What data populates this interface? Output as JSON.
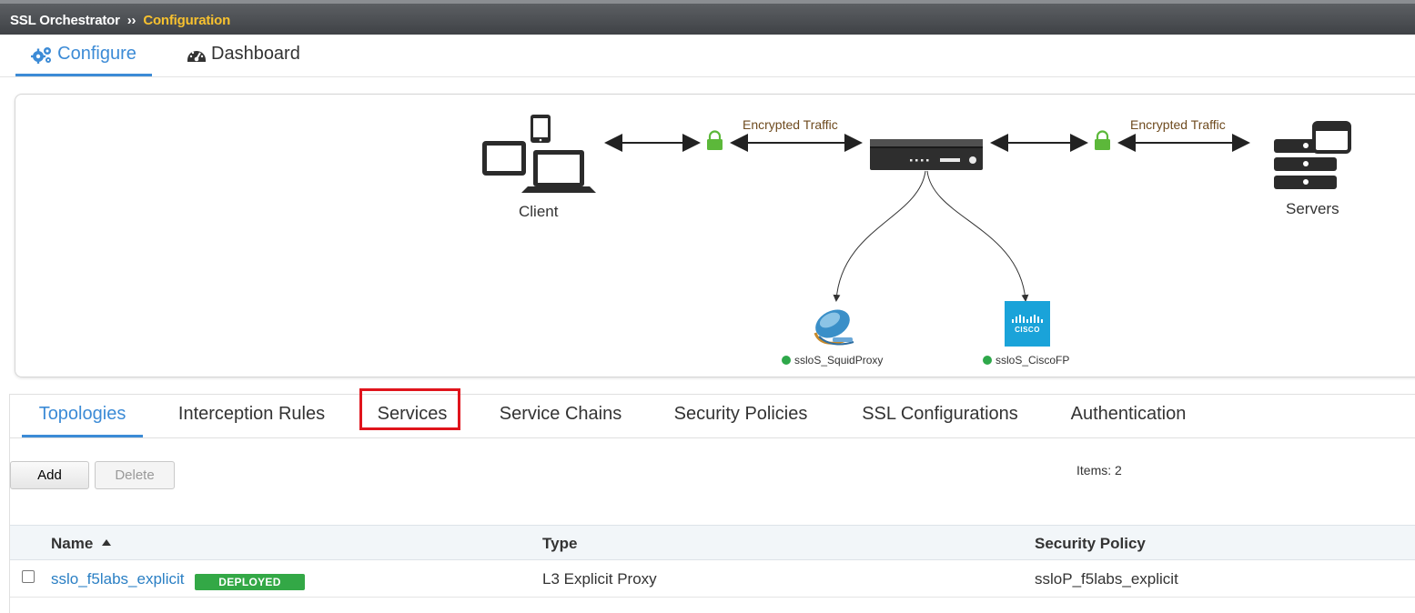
{
  "header": {
    "app_name": "SSL Orchestrator",
    "separator": "››",
    "current": "Configuration"
  },
  "main_tabs": [
    {
      "label": "Configure",
      "icon": "gears-icon",
      "active": true
    },
    {
      "label": "Dashboard",
      "icon": "dashboard-gauge-icon",
      "active": false
    }
  ],
  "diagram": {
    "client_label": "Client",
    "servers_label": "Servers",
    "encrypted_left": "Encrypted Traffic",
    "encrypted_right": "Encrypted Traffic",
    "services": [
      {
        "name": "ssloS_SquidProxy",
        "status": "green",
        "icon": "squid-icon"
      },
      {
        "name": "ssloS_CiscoFP",
        "status": "green",
        "icon": "cisco-logo-icon"
      }
    ],
    "cisco_logo_text": "CISCO"
  },
  "sub_tabs": [
    {
      "label": "Topologies",
      "active": true
    },
    {
      "label": "Interception Rules",
      "active": false
    },
    {
      "label": "Services",
      "active": false,
      "highlighted": true
    },
    {
      "label": "Service Chains",
      "active": false
    },
    {
      "label": "Security Policies",
      "active": false
    },
    {
      "label": "SSL Configurations",
      "active": false
    },
    {
      "label": "Authentication",
      "active": false
    }
  ],
  "toolbar": {
    "add_label": "Add",
    "delete_label": "Delete",
    "items_count": "Items: 2"
  },
  "table": {
    "columns": [
      "Name",
      "Type",
      "Security Policy"
    ],
    "rows": [
      {
        "name": "sslo_f5labs_explicit",
        "badge": "DEPLOYED",
        "type": "L3 Explicit Proxy",
        "policy": "ssloP_f5labs_explicit"
      }
    ]
  },
  "colors": {
    "accent": "#3c8bd6",
    "current_crumb": "#f7c12f",
    "deployed": "#33a846",
    "highlight": "#e0141c",
    "status_ok": "#2ea84a"
  }
}
